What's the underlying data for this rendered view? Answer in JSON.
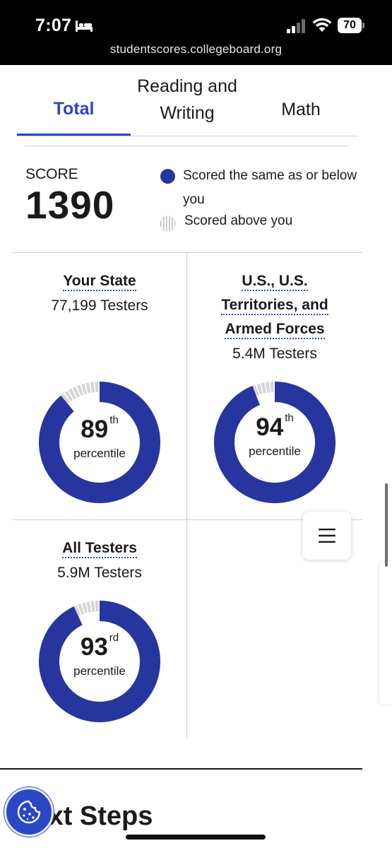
{
  "status_bar": {
    "time": "7:07",
    "battery": "70",
    "url": "studentscores.collegeboard.org"
  },
  "tabs": [
    {
      "label": "Total",
      "active": true
    },
    {
      "label": "Reading and Writing",
      "line1": "Reading and",
      "line2": "Writing",
      "active": false
    },
    {
      "label": "Math",
      "active": false
    }
  ],
  "score": {
    "label": "SCORE",
    "value": "1390"
  },
  "legend": {
    "same_or_below": "Scored the same as or below you",
    "above": "Scored above you"
  },
  "groups": [
    {
      "name": "Your State",
      "testers": "77,199 Testers",
      "percentile": "89",
      "suffix": "th",
      "percentile_label": "percentile",
      "fraction": 0.89
    },
    {
      "name": "U.S., U.S. Territories, and Armed Forces",
      "name_line1": "U.S., U.S.",
      "name_line2": "Territories, and",
      "name_line3": "Armed Forces",
      "testers": "5.4M Testers",
      "percentile": "94",
      "suffix": "th",
      "percentile_label": "percentile",
      "fraction": 0.94
    },
    {
      "name": "All Testers",
      "testers": "5.9M Testers",
      "percentile": "93",
      "suffix": "rd",
      "percentile_label": "percentile",
      "fraction": 0.93
    }
  ],
  "next_steps": {
    "heading": "Next Steps"
  },
  "icons": [
    "bed-icon",
    "signal-icon",
    "wifi-icon",
    "battery-icon",
    "menu-icon",
    "cookie-icon"
  ],
  "colors": {
    "accent": "#2d45c8",
    "donut_fill": "#27359e",
    "donut_rest": "#d6d6d6",
    "status_bar": "#000000"
  }
}
